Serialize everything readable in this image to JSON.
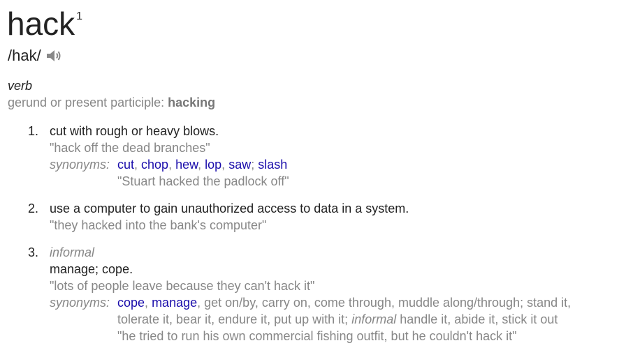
{
  "headword": {
    "text": "hack",
    "sup": "1"
  },
  "pronunciation": "/hak/",
  "part_of_speech": "verb",
  "inflection": {
    "label": "gerund or present participle:",
    "form": "hacking"
  },
  "senses": [
    {
      "number": "1.",
      "definition": "cut with rough or heavy blows.",
      "example": "\"hack off the dead branches\"",
      "synonyms_label": "synonyms:",
      "synonyms": [
        "cut",
        "chop",
        "hew",
        "lop",
        "saw",
        "slash"
      ],
      "syn_example": "\"Stuart hacked the padlock off\""
    },
    {
      "number": "2.",
      "definition": "use a computer to gain unauthorized access to data in a system.",
      "example": "\"they hacked into the bank's computer\""
    },
    {
      "number": "3.",
      "register": "informal",
      "definition": "manage; cope.",
      "example": "\"lots of people leave because they can't hack it\"",
      "synonyms_label": "synonyms:",
      "synonyms_links": [
        "cope",
        "manage"
      ],
      "synonyms_plain_1": "get on/by, carry on, come through, muddle along/through; stand it,",
      "synonyms_plain_2": "tolerate it, bear it, endure it, put up with it;",
      "synonyms_register": "informal",
      "synonyms_plain_3": "handle it, abide it, stick it out",
      "syn_example": "\"he tried to run his own commercial fishing outfit, but he couldn't hack it\""
    }
  ],
  "colors": {
    "text": "#222222",
    "muted": "#878787",
    "link": "#1a0dab"
  },
  "icons": {
    "audio": "speaker-icon"
  }
}
